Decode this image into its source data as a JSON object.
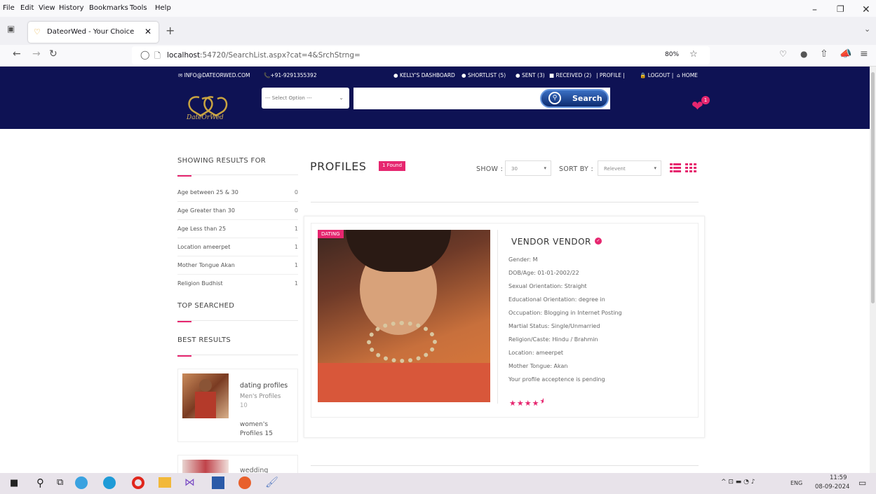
{
  "browser": {
    "menu": [
      "File",
      "Edit",
      "View",
      "History",
      "Bookmarks",
      "Tools",
      "Help"
    ],
    "tab_title": "DateorWed - Your Choice",
    "url_host": "localhost",
    "url_rest": ":54720/SearchList.aspx?cat=4&SrchStrng=",
    "zoom": "80%"
  },
  "header": {
    "email": "INFO@DATEORWED.COM",
    "phone": "+91-9291355392",
    "dashboard": "KELLY'S DASHBOARD",
    "shortlist": "SHORTLIST (5)",
    "sent": "SENT (3)",
    "received": "RECEIVED (2)",
    "profile_link": "| PROFILE |",
    "logout_link": "LOGOUT |",
    "home_link": "HOME",
    "select_placeholder": "--- Select Option ---",
    "search_label": "Search",
    "logo_text": "DateOrWed",
    "heart_count": "1"
  },
  "sidebar": {
    "showing_title": "SHOWING RESULTS FOR",
    "filters": [
      {
        "label": "Age between 25 & 30",
        "count": "0"
      },
      {
        "label": "Age Greater than 30",
        "count": "0"
      },
      {
        "label": "Age Less than 25",
        "count": "1"
      },
      {
        "label": "Location ameerpet",
        "count": "1"
      },
      {
        "label": "Mother Tongue Akan",
        "count": "1"
      },
      {
        "label": "Religion Budhist",
        "count": "1"
      }
    ],
    "top_searched": "TOP SEARCHED",
    "best_results": "BEST RESULTS",
    "best_cards": [
      {
        "title": "dating profiles",
        "sub1": "Men's Profiles",
        "sub2": "10",
        "sub3": "women's",
        "sub4": "Profiles 15"
      },
      {
        "title": "wedding"
      }
    ]
  },
  "main": {
    "title": "PROFILES",
    "found": "1 Found",
    "show_label": "SHOW :",
    "show_value": "30",
    "sort_label": "SORT BY :",
    "sort_value": "Relevent",
    "profile": {
      "tag": "DATING",
      "name": "VENDOR VENDOR",
      "details": [
        "Gender: M",
        "DOB/Age: 01-01-2002/22",
        "Sexual Orientation: Straight",
        "Educational Orientation: degree in",
        "Occupation: Blogging in Internet Posting",
        "Martial Status: Single/Unmarried",
        "Religion/Caste: Hindu / Brahmin",
        "Location: ameerpet",
        "Mother Tongue: Akan",
        "Your profile acceptence is pending"
      ],
      "rating": 4.5
    }
  },
  "taskbar": {
    "lang": "ENG",
    "time": "11:59",
    "date": "08-09-2024"
  },
  "colors": {
    "navy": "#0e1254",
    "pink": "#e6266f"
  }
}
